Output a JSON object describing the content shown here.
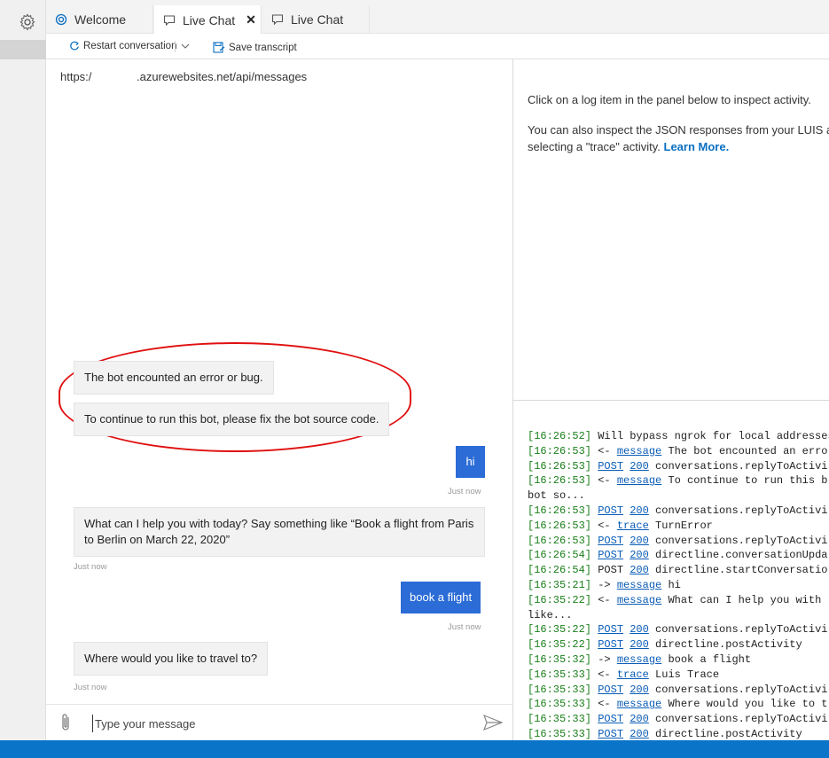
{
  "tabs": [
    {
      "label": "Welcome"
    },
    {
      "label": "Live Chat",
      "active": true
    },
    {
      "label": "Live Chat"
    }
  ],
  "toolbar": {
    "restart_label": "Restart conversation",
    "save_label": "Save transcript"
  },
  "chat": {
    "endpoint": "https:/              .azurewebsites.net/api/messages",
    "messages": [
      {
        "from": "bot",
        "text": "The bot encounted an error or bug."
      },
      {
        "from": "bot",
        "text": "To continue to run this bot, please fix the bot source code."
      },
      {
        "from": "user",
        "text": "hi",
        "time": "Just now"
      },
      {
        "from": "bot",
        "text": "What can I help you with today? Say something like “Book a flight from Paris to Berlin on March 22, 2020”",
        "time": "Just now"
      },
      {
        "from": "user",
        "text": "book a flight",
        "time": "Just now"
      },
      {
        "from": "bot",
        "text": "Where would you like to travel to?",
        "time": "Just now"
      }
    ],
    "input_placeholder": "Type your message"
  },
  "inspector": {
    "line1": "Click on a log item in the panel below to inspect activity.",
    "line2": "You can also inspect the JSON responses from your LUIS an",
    "line3": "selecting a \"trace\" activity.",
    "learn_more": "Learn More."
  },
  "log": [
    {
      "ts": "[16:26:52]",
      "link": "",
      "code": "",
      "text": " Will bypass ngrok for local addresses"
    },
    {
      "ts": "[16:26:53]",
      "prefix": " <- ",
      "link": "message",
      "code": "",
      "text": " The bot encounted an erro"
    },
    {
      "ts": "[16:26:53]",
      "prefix": " ",
      "link": "POST",
      "code": "200",
      "text": " conversations.replyToActivi"
    },
    {
      "ts": "[16:26:53]",
      "prefix": " <- ",
      "link": "message",
      "code": "",
      "text": " To continue to run this b"
    },
    {
      "ts": "",
      "link": "",
      "code": "",
      "text": "bot so..."
    },
    {
      "ts": "[16:26:53]",
      "prefix": " ",
      "link": "POST",
      "code": "200",
      "text": " conversations.replyToActivi"
    },
    {
      "ts": "[16:26:53]",
      "prefix": " <- ",
      "link": "trace",
      "code": "",
      "text": " TurnError"
    },
    {
      "ts": "[16:26:53]",
      "prefix": " ",
      "link": "POST",
      "code": "200",
      "text": " conversations.replyToActivi"
    },
    {
      "ts": "[16:26:54]",
      "prefix": " ",
      "link": "POST",
      "code": "200",
      "text": " directline.conversationUpda"
    },
    {
      "ts": "[16:26:54]",
      "prefix": " POST ",
      "link": "",
      "code": "200",
      "text": " directline.startConversatio"
    },
    {
      "ts": "[16:35:21]",
      "prefix": " -> ",
      "link": "message",
      "code": "",
      "text": " hi"
    },
    {
      "ts": "[16:35:22]",
      "prefix": " <- ",
      "link": "message",
      "code": "",
      "text": " What can I help you with"
    },
    {
      "ts": "",
      "link": "",
      "code": "",
      "text": "like..."
    },
    {
      "ts": "[16:35:22]",
      "prefix": " ",
      "link": "POST",
      "code": "200",
      "text": " conversations.replyToActivi"
    },
    {
      "ts": "[16:35:22]",
      "prefix": " ",
      "link": "POST",
      "code": "200",
      "text": " directline.postActivity"
    },
    {
      "ts": "[16:35:32]",
      "prefix": " -> ",
      "link": "message",
      "code": "",
      "text": " book a flight"
    },
    {
      "ts": "[16:35:33]",
      "prefix": " <- ",
      "link": "trace",
      "code": "",
      "text": " Luis Trace"
    },
    {
      "ts": "[16:35:33]",
      "prefix": " ",
      "link": "POST",
      "code": "200",
      "text": " conversations.replyToActivi"
    },
    {
      "ts": "[16:35:33]",
      "prefix": " <- ",
      "link": "message",
      "code": "",
      "text": " Where would you like to t"
    },
    {
      "ts": "[16:35:33]",
      "prefix": " ",
      "link": "POST",
      "code": "200",
      "text": " conversations.replyToActivi"
    },
    {
      "ts": "[16:35:33]",
      "prefix": " ",
      "link": "POST",
      "code": "200",
      "text": " directline.postActivity"
    }
  ],
  "colors": {
    "accent": "#0a74c9",
    "user_bubble": "#2b6cd6",
    "annotation": "#e01010",
    "link": "#0a5cb5",
    "timestamp": "#1a7f1a"
  },
  "icons": {
    "settings": "gear-icon",
    "welcome_tab": "welcome-icon",
    "chat_tab": "chat-icon",
    "restart": "restart-icon",
    "save": "save-icon",
    "attach": "paperclip-icon",
    "send": "send-icon"
  }
}
